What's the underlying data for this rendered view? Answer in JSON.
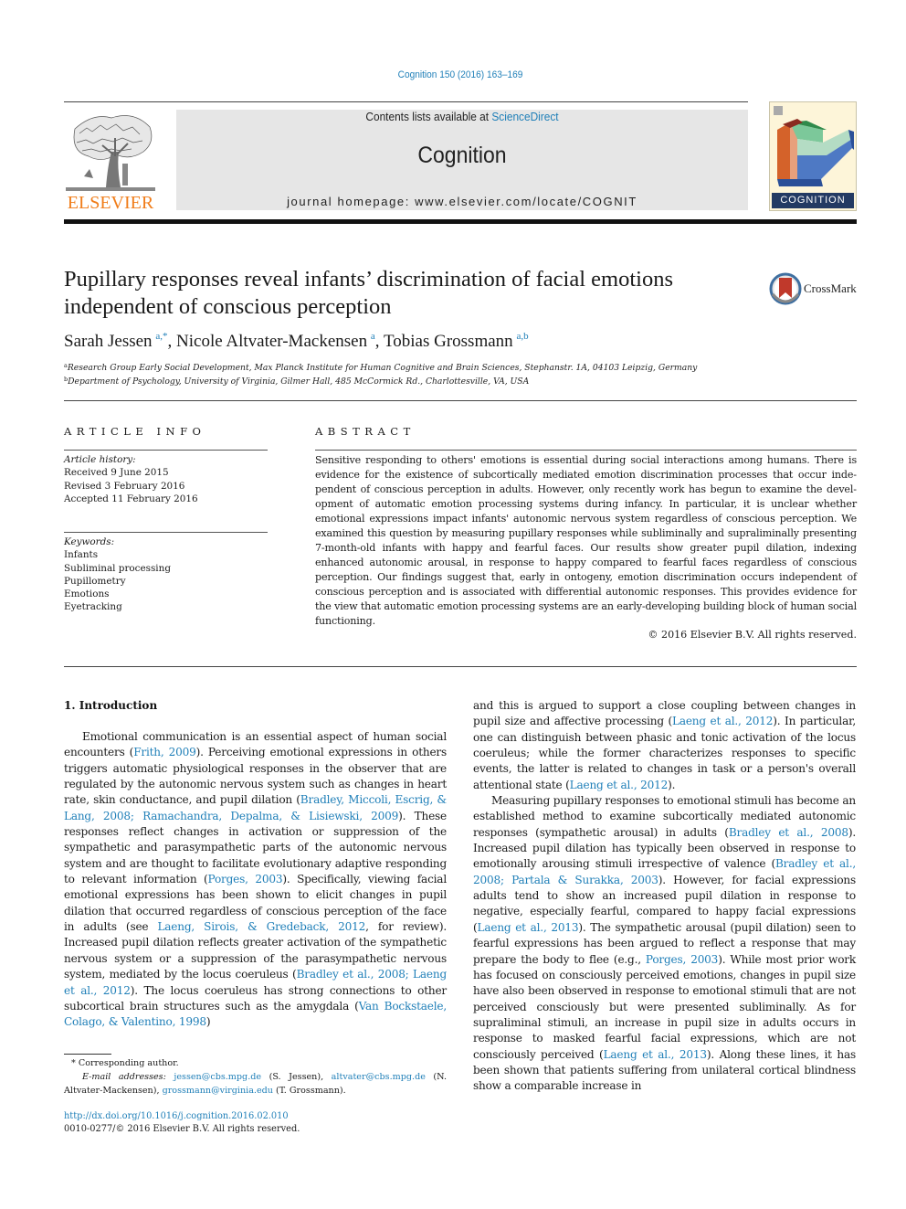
{
  "header": {
    "journal_reference": "Cognition 150 (2016) 163–169",
    "contents_prefix": "Contents lists available at ",
    "contents_link": "ScienceDirect",
    "journal_title": "Cognition",
    "homepage": "journal homepage: www.elsevier.com/locate/COGNIT",
    "publisher_logo_text": "ELSEVIER",
    "cover_label": "COGNITION",
    "colors": {
      "link": "#1f7fb8",
      "elsevier_orange": "#f07d1a",
      "cover_band": "#233a63"
    }
  },
  "article": {
    "title": "Pupillary responses reveal infants’ discrimination of facial emotions independent of conscious perception",
    "crossmark_label": "CrossMark",
    "authors": [
      {
        "name": "Sarah Jessen",
        "sup": "a,*"
      },
      {
        "name": "Nicole Altvater-Mackensen",
        "sup": "a"
      },
      {
        "name": "Tobias Grossmann",
        "sup": "a,b"
      }
    ],
    "affiliations": [
      {
        "mark": "a",
        "text": "Research Group Early Social Development, Max Planck Institute for Human Cognitive and Brain Sciences, Stephanstr. 1A, 04103 Leipzig, Germany"
      },
      {
        "mark": "b",
        "text": "Department of Psychology, University of Virginia, Gilmer Hall, 485 McCormick Rd., Charlottesville, VA, USA"
      }
    ]
  },
  "article_info": {
    "heading": "ARTICLE INFO",
    "history_label": "Article history:",
    "history": [
      "Received 9 June 2015",
      "Revised 3 February 2016",
      "Accepted 11 February 2016"
    ],
    "keywords_label": "Keywords:",
    "keywords": [
      "Infants",
      "Subliminal processing",
      "Pupillometry",
      "Emotions",
      "Eyetracking"
    ]
  },
  "abstract": {
    "heading": "ABSTRACT",
    "text": "Sensitive responding to others' emotions is essential during social interactions among humans. There is evidence for the existence of subcortically mediated emotion discrimination processes that occur inde­pendent of conscious perception in adults. However, only recently work has begun to examine the devel­opment of automatic emotion processing systems during infancy. In particular, it is unclear whether emotional expressions impact infants' autonomic nervous system regardless of conscious perception. We examined this question by measuring pupillary responses while subliminally and supraliminally pre­senting 7-month-old infants with happy and fearful faces. Our results show greater pupil dilation, index­ing enhanced autonomic arousal, in response to happy compared to fearful faces regardless of conscious perception. Our findings suggest that, early in ontogeny, emotion discrimination occurs independent of conscious perception and is associated with differential autonomic responses. This provides evidence for the view that automatic emotion processing systems are an early-developing building block of human social functioning.",
    "copyright": "© 2016 Elsevier B.V. All rights reserved."
  },
  "body": {
    "section_heading": "1. Introduction",
    "left": {
      "s1": "Emotional communication is an essential aspect of human social encounters (",
      "c1": "Frith, 2009",
      "s2": "). Perceiving emotional expressions in others triggers automatic physiological responses in the obser­ver that are regulated by the autonomic nervous system such as changes in heart rate, skin conductance, and pupil dilation (",
      "c2": "Bradley, Miccoli, Escrig, & Lang, 2008; Ramachandra, Depalma, & Lisiewski, 2009",
      "s3": "). These responses reflect changes in activation or suppression of the sympathetic and parasympathetic parts of the autonomic nervous system and are thought to facilitate evolution­ary adaptive responding to relevant information (",
      "c3": "Porges, 2003",
      "s4": "). Specifically, viewing facial emotional expressions has been shown to elicit changes in pupil dilation that occurred regardless of con­scious perception of the face in adults (see ",
      "c4": "Laeng, Sirois, & Gredeback, 2012",
      "s5": ", for review). Increased pupil dilation reflects greater activation of the sympathetic nervous system or a suppres­sion of the parasympathetic nervous system, mediated by the locus coeruleus (",
      "c5": "Bradley et al., 2008; Laeng et al., 2012",
      "s6": "). The locus coer­uleus has strong connections to other subcortical brain structures such as the amygdala (",
      "c6": "Van Bockstaele, Colago, & Valentino, 1998",
      "s7": ")"
    },
    "right_p1": {
      "s1": "and this is argued to support a close coupling between changes in pupil size and affective processing (",
      "c1": "Laeng et al., 2012",
      "s2": "). In partic­ular, one can distinguish between phasic and tonic activation of the locus coeruleus; while the former characterizes responses to speci­fic events, the latter is related to changes in task or a person's over­all attentional state (",
      "c2": "Laeng et al., 2012",
      "s3": ")."
    },
    "right_p2": {
      "s1": "Measuring pupillary responses to emotional stimuli has become an established method to examine subcortically mediated auto­nomic responses (sympathetic arousal) in adults (",
      "c1": "Bradley et al., 2008",
      "s2": "). Increased pupil dilation has typically been observed in response to emotionally arousing stimuli irrespective of valence (",
      "c2": "Bradley et al., 2008; Partala & Surakka, 2003",
      "s3": "). However, for facial expressions adults tend to show an increased pupil dilation in response to negative, especially fearful, compared to happy facial expressions (",
      "c3": "Laeng et al., 2013",
      "s4": "). The sympathetic arousal (pupil dilation) seen to fearful expressions has been argued to reflect a response that may prepare the body to flee (e.g., ",
      "c4": "Porges, 2003",
      "s5": "). While most prior work has focused on consciously perceived emo­tions, changes in pupil size have also been observed in response to emotional stimuli that are not perceived consciously but were pre­sented subliminally. As for supraliminal stimuli, an increase in pupil size in adults occurs in response to masked fearful facial expressions, which are not consciously perceived (",
      "c5": "Laeng et al., 2013",
      "s6": "). Along these lines, it has been shown that patients suffering from unilateral cortical blindness show a comparable increase in"
    }
  },
  "footnotes": {
    "star": "*",
    "corresponding": "Corresponding author.",
    "email_label": "E-mail addresses:",
    "emails": [
      {
        "addr": "jessen@cbs.mpg.de",
        "who": " (S. Jessen), "
      },
      {
        "addr": "altvater@cbs.mpg.de",
        "who": " (N. Altvater-Mackensen), "
      },
      {
        "addr": "grossmann@virginia.edu",
        "who": " (T. Grossmann)."
      }
    ],
    "doi": "http://dx.doi.org/10.1016/j.cognition.2016.02.010",
    "issn_copyright": "0010-0277/© 2016 Elsevier B.V. All rights reserved."
  }
}
